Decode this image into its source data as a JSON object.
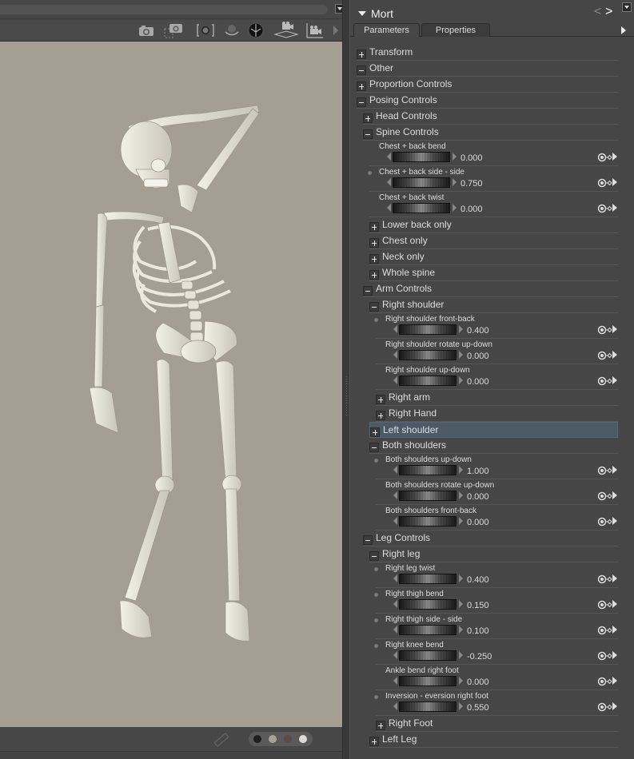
{
  "viewport": {
    "toolbar_icons": [
      "camera-icon",
      "camera-frame-icon",
      "frame-camera-icon",
      "orbit-icon",
      "sphere-icon",
      "camera-ground-icon",
      "camera-corner-icon",
      "toolbar-more-icon"
    ],
    "swatches": [
      "#1e1e1e",
      "#a8a394",
      "#5a4a48",
      "#dedcd2"
    ],
    "figure_description": "Posed skeleton figure"
  },
  "panel": {
    "title": "Mort",
    "nav_prev": "<",
    "nav_next": ">",
    "tabs": [
      {
        "label": "Parameters",
        "active": true
      },
      {
        "label": "Properties",
        "active": false
      }
    ]
  },
  "rows": [
    {
      "type": "group",
      "label": "Transform",
      "state": "collapsed",
      "level": 0
    },
    {
      "type": "group",
      "label": "Other",
      "state": "expanded",
      "level": 0
    },
    {
      "type": "group",
      "label": "Proportion Controls",
      "state": "collapsed",
      "level": 0
    },
    {
      "type": "group",
      "label": "Posing Controls",
      "state": "expanded",
      "level": 0
    },
    {
      "type": "group",
      "label": "Head Controls",
      "state": "collapsed",
      "level": 1
    },
    {
      "type": "group",
      "label": "Spine Controls",
      "state": "expanded",
      "level": 1
    },
    {
      "type": "slider",
      "label": "Chest + back bend",
      "value": "0.000",
      "modified": false,
      "level": 2
    },
    {
      "type": "slider",
      "label": "Chest + back side - side",
      "value": "0.750",
      "modified": true,
      "level": 2
    },
    {
      "type": "slider",
      "label": "Chest + back twist",
      "value": "0.000",
      "modified": false,
      "level": 2
    },
    {
      "type": "group",
      "label": "Lower back only",
      "state": "collapsed",
      "level": 2
    },
    {
      "type": "group",
      "label": "Chest only",
      "state": "collapsed",
      "level": 2
    },
    {
      "type": "group",
      "label": "Neck only",
      "state": "collapsed",
      "level": 2
    },
    {
      "type": "group",
      "label": "Whole spine",
      "state": "collapsed",
      "level": 2
    },
    {
      "type": "group",
      "label": "Arm Controls",
      "state": "expanded",
      "level": 1
    },
    {
      "type": "group",
      "label": "Right shoulder",
      "state": "expanded",
      "level": 2
    },
    {
      "type": "slider",
      "label": "Right shoulder front-back",
      "value": "0.400",
      "modified": true,
      "level": 3
    },
    {
      "type": "slider",
      "label": "Right shoulder rotate up-down",
      "value": "0.000",
      "modified": false,
      "level": 3
    },
    {
      "type": "slider",
      "label": "Right shoulder up-down",
      "value": "0.000",
      "modified": false,
      "level": 3
    },
    {
      "type": "group",
      "label": "Right arm",
      "state": "collapsed",
      "level": 3
    },
    {
      "type": "group",
      "label": "Right Hand",
      "state": "collapsed",
      "level": 3
    },
    {
      "type": "group",
      "label": "Left shoulder",
      "state": "collapsed",
      "level": 2,
      "selected": true
    },
    {
      "type": "group",
      "label": "Both shoulders",
      "state": "expanded",
      "level": 2
    },
    {
      "type": "slider",
      "label": "Both shoulders up-down",
      "value": "1.000",
      "modified": true,
      "level": 3
    },
    {
      "type": "slider",
      "label": "Both shoulders rotate up-down",
      "value": "0.000",
      "modified": false,
      "level": 3
    },
    {
      "type": "slider",
      "label": "Both shoulders front-back",
      "value": "0.000",
      "modified": false,
      "level": 3
    },
    {
      "type": "group",
      "label": "Leg Controls",
      "state": "expanded",
      "level": 1
    },
    {
      "type": "group",
      "label": "Right leg",
      "state": "expanded",
      "level": 2
    },
    {
      "type": "slider",
      "label": "Right leg twist",
      "value": "0.400",
      "modified": true,
      "level": 3
    },
    {
      "type": "slider",
      "label": "Right thigh bend",
      "value": "0.150",
      "modified": true,
      "level": 3
    },
    {
      "type": "slider",
      "label": "Right thigh side - side",
      "value": "0.100",
      "modified": true,
      "level": 3
    },
    {
      "type": "slider",
      "label": "Right knee bend",
      "value": "-0.250",
      "modified": true,
      "level": 3
    },
    {
      "type": "slider",
      "label": "Ankle bend right foot",
      "value": "0.000",
      "modified": false,
      "level": 3
    },
    {
      "type": "slider",
      "label": "Inversion - eversion right foot",
      "value": "0.550",
      "modified": true,
      "level": 3
    },
    {
      "type": "group",
      "label": "Right Foot",
      "state": "collapsed",
      "level": 3
    },
    {
      "type": "group",
      "label": "Left Leg",
      "state": "collapsed",
      "level": 2
    }
  ]
}
